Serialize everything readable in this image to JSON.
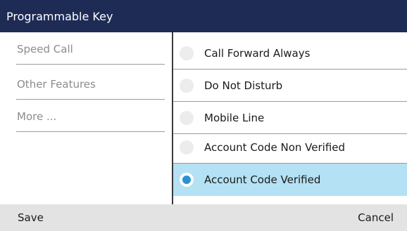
{
  "header": {
    "title": "Programmable Key"
  },
  "left_menu": {
    "items": [
      {
        "label": "Speed Call"
      },
      {
        "label": "Other Features"
      },
      {
        "label": "More ..."
      }
    ]
  },
  "options": {
    "items": [
      {
        "label": "Call Forward Always",
        "selected": false
      },
      {
        "label": "Do Not Disturb",
        "selected": false
      },
      {
        "label": "Mobile Line",
        "selected": false
      },
      {
        "label": "Account Code Non Verified",
        "selected": false
      },
      {
        "label": "Account Code Verified",
        "selected": true
      }
    ]
  },
  "footer": {
    "save_label": "Save",
    "cancel_label": "Cancel"
  },
  "colors": {
    "header_bg": "#1d2b55",
    "selected_bg": "#b4e1f4",
    "radio_dot": "#2a93d1",
    "footer_bg": "#e3e3e3"
  }
}
